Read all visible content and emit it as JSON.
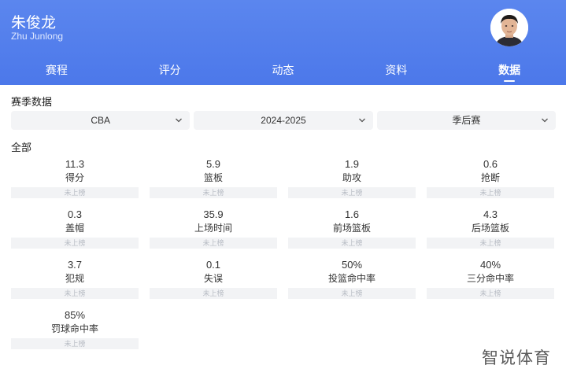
{
  "header": {
    "name": "朱俊龙",
    "name_en": "Zhu Junlong"
  },
  "tabs": [
    {
      "label": "赛程",
      "active": false
    },
    {
      "label": "评分",
      "active": false
    },
    {
      "label": "动态",
      "active": false
    },
    {
      "label": "资料",
      "active": false
    },
    {
      "label": "数据",
      "active": true
    }
  ],
  "season": {
    "title": "赛季数据",
    "filters": [
      {
        "value": "CBA"
      },
      {
        "value": "2024-2025"
      },
      {
        "value": "季后赛"
      }
    ],
    "group_label": "全部"
  },
  "stats": [
    {
      "value": "11.3",
      "label": "得分",
      "rank": "未上榜"
    },
    {
      "value": "5.9",
      "label": "篮板",
      "rank": "未上榜"
    },
    {
      "value": "1.9",
      "label": "助攻",
      "rank": "未上榜"
    },
    {
      "value": "0.6",
      "label": "抢断",
      "rank": "未上榜"
    },
    {
      "value": "0.3",
      "label": "盖帽",
      "rank": "未上榜"
    },
    {
      "value": "35.9",
      "label": "上场时间",
      "rank": "未上榜"
    },
    {
      "value": "1.6",
      "label": "前场篮板",
      "rank": "未上榜"
    },
    {
      "value": "4.3",
      "label": "后场篮板",
      "rank": "未上榜"
    },
    {
      "value": "3.7",
      "label": "犯规",
      "rank": "未上榜"
    },
    {
      "value": "0.1",
      "label": "失误",
      "rank": "未上榜"
    },
    {
      "value": "50%",
      "label": "投篮命中率",
      "rank": "未上榜"
    },
    {
      "value": "40%",
      "label": "三分命中率",
      "rank": "未上榜"
    },
    {
      "value": "85%",
      "label": "罚球命中率",
      "rank": "未上榜"
    }
  ],
  "watermark": "智说体育",
  "colors": {
    "header": "#4c78ea",
    "chip_bg": "#f3f4f6",
    "rank_text": "#b8bcc4"
  },
  "icons": {
    "avatar": "player-avatar",
    "dropdown": "chevron-down-icon"
  }
}
